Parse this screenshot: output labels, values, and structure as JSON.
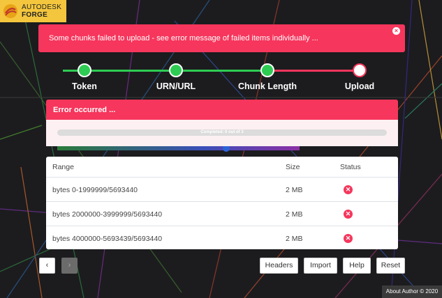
{
  "logo": {
    "line1": "AUTODESK",
    "line2": "FORGE"
  },
  "alert": {
    "message": "Some chunks failed to upload - see error message of failed items individually ...",
    "close_glyph": "×"
  },
  "stepper": {
    "steps": [
      {
        "label": "Token",
        "state": "done"
      },
      {
        "label": "URN/URL",
        "state": "done"
      },
      {
        "label": "Chunk Length",
        "state": "done"
      },
      {
        "label": "Upload",
        "state": "pending"
      }
    ]
  },
  "error_card": {
    "title": "Error occurred ...",
    "progress_text": "Completed: 0 out of 3",
    "progress_value": 0
  },
  "table": {
    "headers": {
      "range": "Range",
      "size": "Size",
      "status": "Status"
    },
    "rows": [
      {
        "range": "bytes 0-1999999/5693440",
        "size": "2 MB",
        "status": "failed",
        "status_glyph": "✕"
      },
      {
        "range": "bytes 2000000-3999999/5693440",
        "size": "2 MB",
        "status": "failed",
        "status_glyph": "✕"
      },
      {
        "range": "bytes 4000000-5693439/5693440",
        "size": "2 MB",
        "status": "failed",
        "status_glyph": "✕"
      }
    ]
  },
  "pagination": {
    "prev": "‹",
    "next": "›"
  },
  "actions": {
    "headers": "Headers",
    "import": "Import",
    "help": "Help",
    "reset": "Reset"
  },
  "footer": {
    "text": "About Author © 2020"
  },
  "colors": {
    "accent": "#f6365c",
    "success": "#2ecc53",
    "logo_bg": "#f4c63d"
  }
}
